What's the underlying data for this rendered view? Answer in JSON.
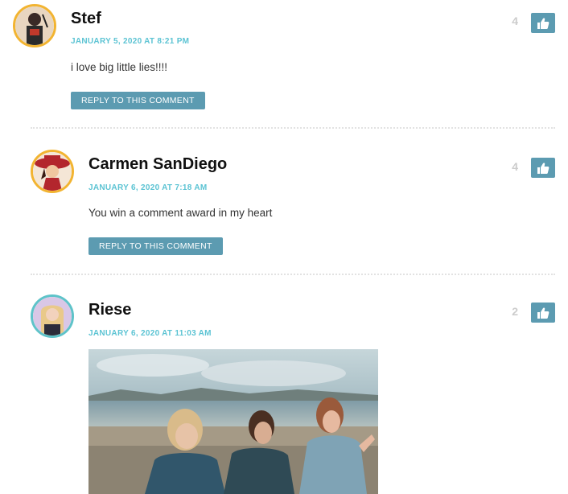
{
  "comments": [
    {
      "author": "Stef",
      "date": "JANUARY 5, 2020 AT 8:21 PM",
      "text": "i love big little lies!!!!",
      "reply_label": "REPLY TO THIS COMMENT",
      "likes": "4"
    },
    {
      "author": "Carmen SanDiego",
      "date": "JANUARY 6, 2020 AT 7:18 AM",
      "text": "You win a comment award in my heart",
      "reply_label": "REPLY TO THIS COMMENT",
      "likes": "4"
    },
    {
      "author": "Riese",
      "date": "JANUARY 6, 2020 AT 11:03 AM",
      "likes": "2",
      "image": "gif-image"
    }
  ],
  "icons": {
    "like": "thumbs-up-icon"
  },
  "colors": {
    "accent": "#5c9bb1",
    "date": "#5bc3d3",
    "avatar_border_gold": "#f2b431",
    "avatar_border_teal": "#5ec3c9"
  }
}
